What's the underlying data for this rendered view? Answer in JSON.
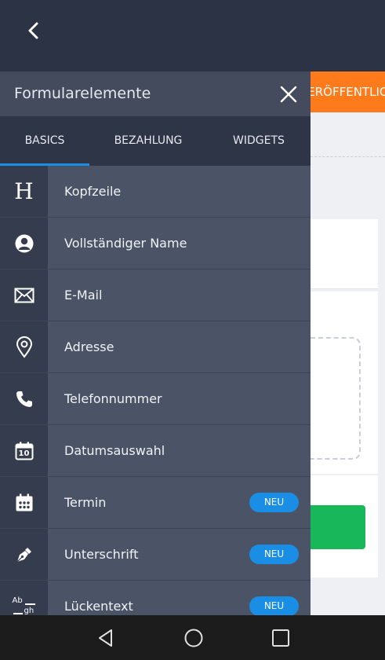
{
  "colors": {
    "topbar": "#2c3345",
    "drawer": "#4a5466",
    "icon_cell": "#343c4d",
    "tabs": "#2e3547",
    "accent_blue": "#1a8ee4",
    "publish_orange": "#ff7a1a",
    "green": "#18b85a"
  },
  "topbar": {
    "back_icon": "chevron-left-icon"
  },
  "background_page": {
    "publish_label": "VERÖFFENTLICHEN"
  },
  "drawer": {
    "title": "Formularelemente",
    "close_icon": "close-icon",
    "tabs": [
      {
        "label": "BASICS",
        "active": true
      },
      {
        "label": "BEZAHLUNG",
        "active": false
      },
      {
        "label": "WIDGETS",
        "active": false
      }
    ],
    "items": [
      {
        "label": "Kopfzeile",
        "icon": "heading-icon"
      },
      {
        "label": "Vollständiger Name",
        "icon": "user-circle-icon"
      },
      {
        "label": "E-Mail",
        "icon": "envelope-icon"
      },
      {
        "label": "Adresse",
        "icon": "map-pin-icon"
      },
      {
        "label": "Telefonnummer",
        "icon": "phone-icon"
      },
      {
        "label": "Datumsauswahl",
        "icon": "calendar-icon",
        "icon_text": "10"
      },
      {
        "label": "Termin",
        "icon": "appointment-icon",
        "badge": "NEU"
      },
      {
        "label": "Unterschrift",
        "icon": "pen-icon",
        "badge": "NEU"
      },
      {
        "label": "Lückentext",
        "icon": "fill-in-blank-icon",
        "icon_text_top": "Ab",
        "icon_text_bottom": "gh",
        "badge": "NEU"
      }
    ]
  },
  "navbar": {
    "back": "triangle-back-icon",
    "home": "circle-home-icon",
    "recents": "square-recents-icon"
  }
}
